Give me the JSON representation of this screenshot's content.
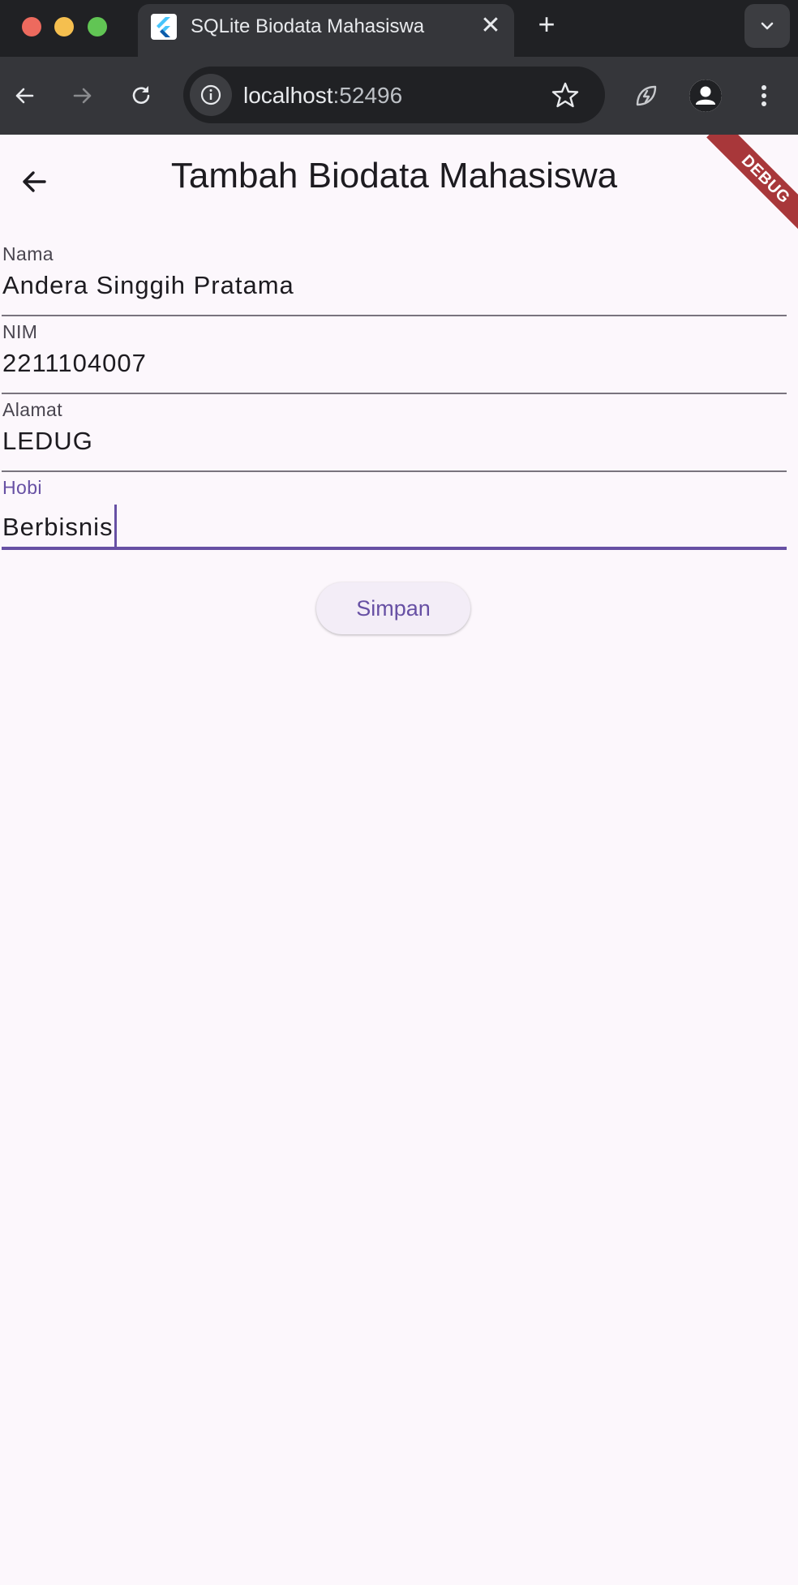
{
  "browser": {
    "tab": {
      "title": "SQLite Biodata Mahasiswa",
      "favicon": "flutter-logo-icon",
      "close_icon": "close-icon"
    },
    "new_tab_icon": "plus-icon",
    "tab_menu_icon": "chevron-down-icon",
    "toolbar": {
      "back_icon": "arrow-left-icon",
      "forward_icon": "arrow-right-icon",
      "reload_icon": "reload-icon",
      "url_host": "localhost",
      "url_port": ":52496",
      "site_info_icon": "info-icon",
      "bookmark_icon": "star-icon",
      "extension_icon": "leaf-bolt-icon",
      "profile_icon": "avatar-icon",
      "menu_icon": "kebab-menu-icon"
    }
  },
  "app": {
    "title": "Tambah Biodata Mahasiswa",
    "debug_banner": "DEBUG",
    "fields": [
      {
        "label": "Nama",
        "value": "Andera Singgih Pratama"
      },
      {
        "label": "NIM",
        "value": "2211104007"
      },
      {
        "label": "Alamat",
        "value": "LEDUG"
      },
      {
        "label": "Hobi",
        "value": "Berbisnis",
        "focused": true
      }
    ],
    "save_button": "Simpan"
  },
  "colors": {
    "primary": "#6750a4",
    "background": "#fcf7fc",
    "debug_banner": "#a8373a",
    "chrome_dark": "#202124",
    "chrome_toolbar": "#35363a"
  }
}
